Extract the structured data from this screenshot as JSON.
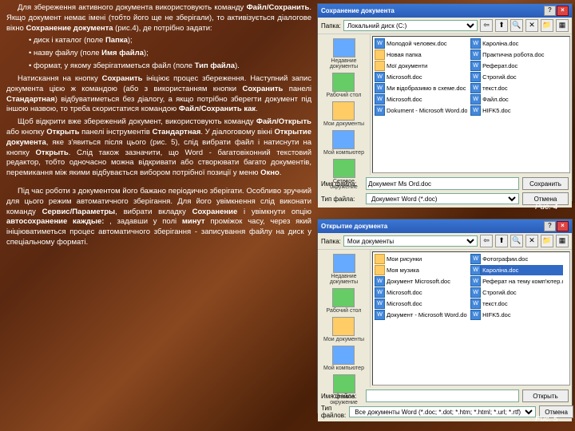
{
  "text": {
    "p1a": "Для збереження активного документа використовують команду ",
    "p1b": "Файл/Сохранить",
    "p1c": ". Якщо документ немає імені (тобто його ще не зберігали), то активізується діалогове вікно ",
    "p1d": "Сохранение документа",
    "p1e": " (рис.4), де потрібно задати:",
    "b1a": "• диск і каталог (поле ",
    "b1b": "Папка",
    "b1c": ");",
    "b2a": "• назву файлу (поле ",
    "b2b": "Имя файла",
    "b2c": ");",
    "b3a": "• формат, у якому зберігатиметься файл (поле ",
    "b3b": "Тип файла",
    "b3c": ").",
    "p2a": "Натискання на кнопку ",
    "p2b": "Сохранить",
    "p2c": " ініціює процес збереження. Наступний запис документа цією ж командою (або з використанням кнопки ",
    "p2d": "Сохранить",
    "p2e": " панелі ",
    "p2f": "Стандартная",
    "p2g": ") відбуватиметься без діалогу, а якщо потрібно зберегти документ під іншою назвою, то треба скористатися командою ",
    "p2h": "Файл/Сохранить как",
    "p2i": ".",
    "p3a": "Щоб відкрити вже збережений документ, використовують команду ",
    "p3b": "Файл/Открыть",
    "p3c": " або кнопку ",
    "p3d": "Открыть",
    "p3e": " панелі інструментів ",
    "p3f": "Стандартная",
    "p3g": ". У діалоговому вікні ",
    "p3h": "Открытие документа",
    "p3i": ", яке з'явиться після цього (рис. 5), слід вибрати файл і натиснути на кнопку ",
    "p3j": "Открыть",
    "p3k": ". Слід також зазначити, що Word - багатовіконний текстовий редактор, тобто одночасно можна відкривати або створювати багато документів, перемикання між якими відбувається вибором потрібної позиції у меню ",
    "p3l": "Окно",
    "p3m": ".",
    "p4a": "Під час роботи з документом його бажано періодично зберігати. Особливо зручний для цього режим автоматичного зберігання. Для його увімкнення слід виконати команду ",
    "p4b": "Сервис/Параметры",
    "p4c": ", вибрати вкладку ",
    "p4d": "Сохранение",
    "p4e": " і увімкнути опцію ",
    "p4f": "автосохранение каждые:",
    "p4g": " , задавши у полі ",
    "p4h": "минут",
    "p4i": " проміжок часу, через який ініціюватиметься процес автоматичного зберігання - записування файлу на диск у спеціальному форматі."
  },
  "dialog1": {
    "title": "Сохранение документа",
    "papka_label": "Папка:",
    "papka_value": "Локальний диск (C:)",
    "sidebar": [
      "Недавние документы",
      "Рабочий стол",
      "Мои документы",
      "Мой компьютер",
      "Сетевое окружение"
    ],
    "files": [
      {
        "t": "Молодой человек.doc",
        "k": "d"
      },
      {
        "t": "Кароліна.doc",
        "k": "d"
      },
      {
        "t": "Новая папка",
        "k": "f"
      },
      {
        "t": "Практична робота.doc",
        "k": "d"
      },
      {
        "t": "Мої документи",
        "k": "f"
      },
      {
        "t": "Реферат.doc",
        "k": "d"
      },
      {
        "t": "Microsoft.doc",
        "k": "d"
      },
      {
        "t": "Строгий.doc",
        "k": "d"
      },
      {
        "t": "Ми відобразимо в схеме.doc",
        "k": "d"
      },
      {
        "t": "текст.doc",
        "k": "d"
      },
      {
        "t": "Microsoft.doc",
        "k": "d"
      },
      {
        "t": "Файл.doc",
        "k": "d"
      },
      {
        "t": "Dokument - Microsoft Word.doc",
        "k": "d"
      },
      {
        "t": "",
        "k": ""
      },
      {
        "t": "HIFK5.doc",
        "k": "d"
      }
    ],
    "fname_label": "Имя файла:",
    "fname_value": "Документ Ms Ord.doc",
    "ftype_label": "Тип файла:",
    "ftype_value": "Документ Word (*.doc)",
    "save_btn": "Сохранить",
    "cancel_btn": "Отмена",
    "caption": "Рис. 4"
  },
  "dialog2": {
    "title": "Открытие документа",
    "papka_label": "Папка:",
    "papka_value": "Мои документы",
    "sidebar": [
      "Недавние документы",
      "Рабочий стол",
      "Мои документы",
      "Мой компьютер",
      "Сетевое окружение"
    ],
    "files": [
      {
        "t": "Мои рисунки",
        "k": "f"
      },
      {
        "t": "Фотографии.doc",
        "k": "d"
      },
      {
        "t": "Моя музика",
        "k": "f"
      },
      {
        "t": "Кароліна.doc",
        "k": "d"
      },
      {
        "t": "Документ Microsoft.doc",
        "k": "d"
      },
      {
        "t": "Реферат на тему комп'ютер.doc",
        "k": "d"
      },
      {
        "t": "Microsoft.doc",
        "k": "d"
      },
      {
        "t": "Строгий.doc",
        "k": "d"
      },
      {
        "t": "Microsoft.doc",
        "k": "d"
      },
      {
        "t": "текст.doc",
        "k": "d"
      },
      {
        "t": "Документ - Microsoft Word.doc",
        "k": "d"
      },
      {
        "t": "",
        "k": ""
      },
      {
        "t": "HIFK5.doc",
        "k": "d"
      }
    ],
    "fname_label": "Имя файла:",
    "fname_value": "",
    "ftype_label": "Тип файлов:",
    "ftype_value": "Все документы Word (*.doc; *.dot; *.htm; *.html; *.url; *.rtf)",
    "open_btn": "Открыть",
    "cancel_btn": "Отмена",
    "caption": "Рис. 5",
    "selected": "Кароліна.doc"
  }
}
